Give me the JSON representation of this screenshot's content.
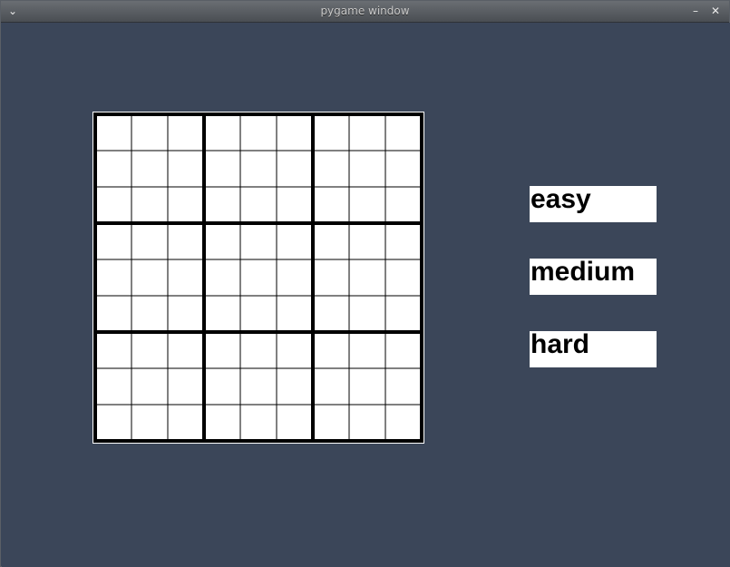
{
  "window": {
    "title": "pygame window",
    "menu_glyph": "⌄",
    "minimize_glyph": "–",
    "close_glyph": "✕"
  },
  "sudoku": {
    "rows": 9,
    "cols": 9,
    "cell_color": "#ffffff",
    "line_color": "#000000",
    "values": [
      [
        "",
        "",
        "",
        "",
        "",
        "",
        "",
        "",
        ""
      ],
      [
        "",
        "",
        "",
        "",
        "",
        "",
        "",
        "",
        ""
      ],
      [
        "",
        "",
        "",
        "",
        "",
        "",
        "",
        "",
        ""
      ],
      [
        "",
        "",
        "",
        "",
        "",
        "",
        "",
        "",
        ""
      ],
      [
        "",
        "",
        "",
        "",
        "",
        "",
        "",
        "",
        ""
      ],
      [
        "",
        "",
        "",
        "",
        "",
        "",
        "",
        "",
        ""
      ],
      [
        "",
        "",
        "",
        "",
        "",
        "",
        "",
        "",
        ""
      ],
      [
        "",
        "",
        "",
        "",
        "",
        "",
        "",
        "",
        ""
      ],
      [
        "",
        "",
        "",
        "",
        "",
        "",
        "",
        "",
        ""
      ]
    ]
  },
  "difficulty": {
    "easy_label": "easy",
    "medium_label": "medium",
    "hard_label": "hard"
  },
  "colors": {
    "background": "#3b4659",
    "button_bg": "#ffffff",
    "button_text": "#000000"
  }
}
